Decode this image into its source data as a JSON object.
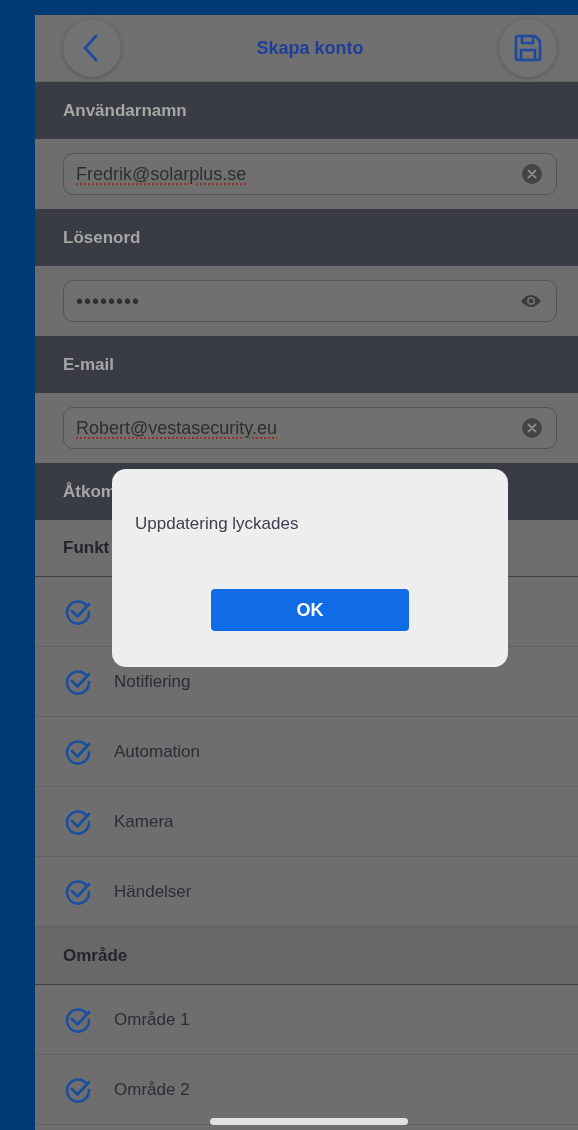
{
  "header": {
    "title": "Skapa konto"
  },
  "fields": [
    {
      "label": "Användarnamn",
      "value": "Fredrik@solarplus.se",
      "kind": "text"
    },
    {
      "label": "Lösenord",
      "value": "••••••••",
      "kind": "password"
    },
    {
      "label": "E-mail",
      "value": "Robert@vestasecurity.eu",
      "kind": "text"
    }
  ],
  "access": {
    "title": "Åtkom",
    "groups": [
      {
        "title": "Funkt",
        "items": [
          {
            "checked": true
          },
          {
            "label": "Notifiering",
            "checked": true
          },
          {
            "label": "Automation",
            "checked": true
          },
          {
            "label": "Kamera",
            "checked": true
          },
          {
            "label": "Händelser",
            "checked": true
          }
        ]
      },
      {
        "title": "Område",
        "items": [
          {
            "label": "Område 1",
            "checked": true
          },
          {
            "label": "Område 2",
            "checked": true
          }
        ]
      }
    ]
  },
  "dialog": {
    "message": "Uppdatering lyckades",
    "button": "OK"
  }
}
